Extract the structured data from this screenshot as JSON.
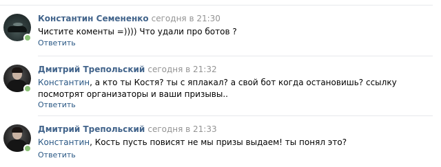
{
  "comments": [
    {
      "author": "Константин Семененко",
      "date": "сегодня в 21:30",
      "mention": "",
      "text": "Чистите коменты =)))) Что удали про ботов ?",
      "reply_label": "Ответить"
    },
    {
      "author": "Дмитрий Трепольский",
      "date": "сегодня в 21:32",
      "mention": "Константин",
      "text": ", а кто ты Костя? ты с яплакал? а свой бот когда остановишь? ссылку посмотрят организаторы и ваши призывы..",
      "reply_label": "Ответить"
    },
    {
      "author": "Дмитрий Трепольский",
      "date": "сегодня в 21:33",
      "mention": "Константин",
      "text": ", Кость пусть повисят не мы призы выдаем! ты понял это?",
      "reply_label": "Ответить"
    }
  ],
  "colors": {
    "author": "#42648b",
    "link": "#2a5885",
    "date": "#939393",
    "online": "#8ac176",
    "divider": "#e7e8ec"
  }
}
